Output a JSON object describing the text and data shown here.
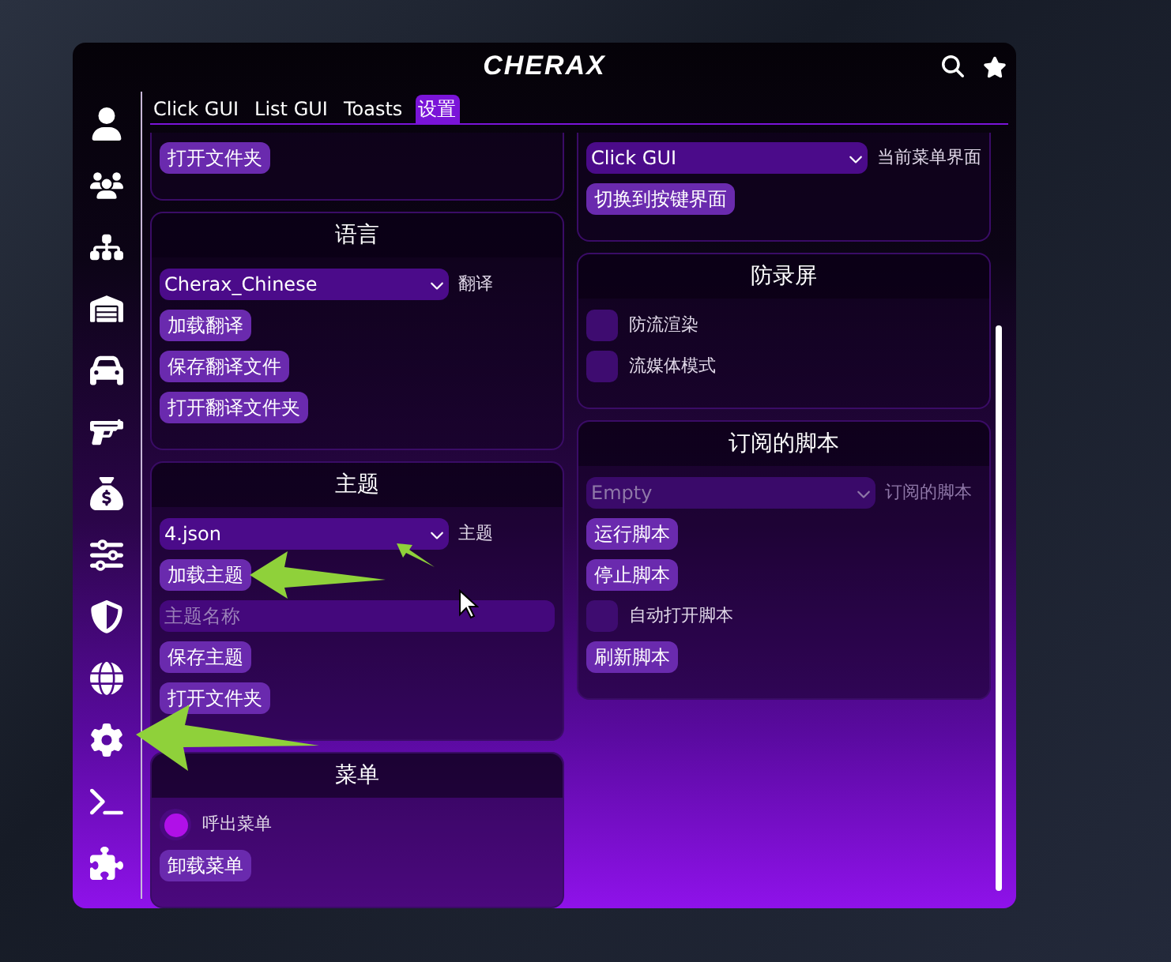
{
  "window": {
    "title": "CHERAX"
  },
  "tabs": [
    {
      "label": "Click GUI",
      "selected": false
    },
    {
      "label": "List GUI",
      "selected": false
    },
    {
      "label": "Toasts",
      "selected": false
    },
    {
      "label": "设置",
      "selected": true
    }
  ],
  "columns": [
    {
      "cards": [
        {
          "items": [
            {
              "kind": "button",
              "label": "打开文件夹"
            }
          ]
        },
        {
          "title": "语言",
          "items": [
            {
              "kind": "dropdown",
              "value": "Cherax_Chinese",
              "caption": "翻译",
              "disabled": false
            },
            {
              "kind": "button",
              "label": "加载翻译"
            },
            {
              "kind": "button",
              "label": "保存翻译文件"
            },
            {
              "kind": "button",
              "label": "打开翻译文件夹"
            }
          ]
        },
        {
          "title": "主题",
          "items": [
            {
              "kind": "dropdown",
              "value": "4.json",
              "caption": "主题",
              "disabled": false
            },
            {
              "kind": "button",
              "label": "加载主题"
            },
            {
              "kind": "input",
              "placeholder": "主题名称"
            },
            {
              "kind": "button",
              "label": "保存主题"
            },
            {
              "kind": "button",
              "label": "打开文件夹"
            }
          ]
        },
        {
          "title": "菜单",
          "items": [
            {
              "kind": "checkbox",
              "label": "呼出菜单",
              "checked": true
            },
            {
              "kind": "button",
              "label": "卸载菜单"
            }
          ]
        }
      ]
    },
    {
      "cards": [
        {
          "items": [
            {
              "kind": "dropdown",
              "value": "Click GUI",
              "caption": "当前菜单界面",
              "disabled": false
            },
            {
              "kind": "button",
              "label": "切换到按键界面"
            }
          ]
        },
        {
          "title": "防录屏",
          "items": [
            {
              "kind": "checkbox",
              "label": "防流渲染",
              "checked": false
            },
            {
              "kind": "checkbox",
              "label": "流媒体模式",
              "checked": false
            }
          ]
        },
        {
          "title": "订阅的脚本",
          "items": [
            {
              "kind": "dropdown",
              "value": "Empty",
              "caption": "订阅的脚本",
              "disabled": true
            },
            {
              "kind": "button",
              "label": "运行脚本"
            },
            {
              "kind": "button",
              "label": "停止脚本"
            },
            {
              "kind": "checkbox",
              "label": "自动打开脚本",
              "checked": false
            },
            {
              "kind": "button",
              "label": "刷新脚本"
            }
          ]
        }
      ]
    }
  ]
}
